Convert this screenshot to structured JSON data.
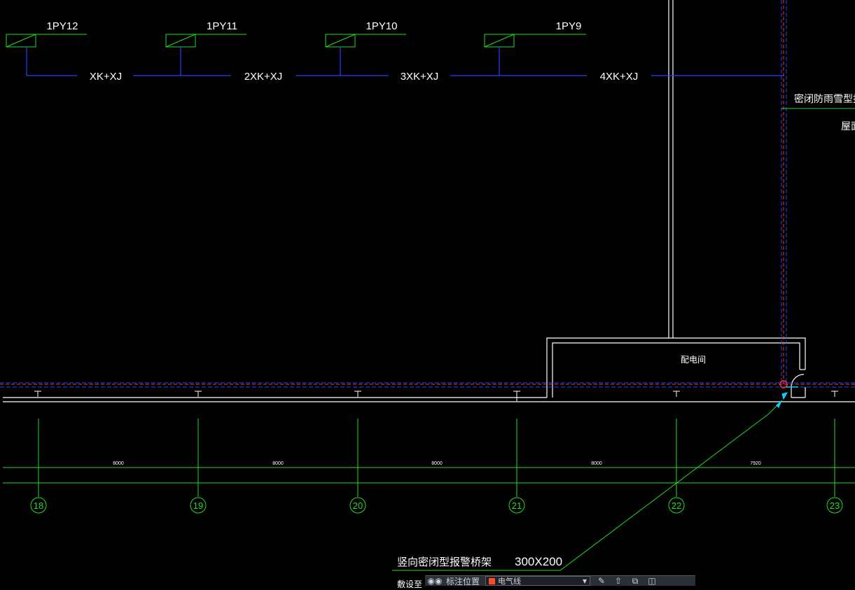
{
  "panels": [
    {
      "label": "1PY12",
      "cable": "XK+XJ"
    },
    {
      "label": "1PY11",
      "cable": "2XK+XJ"
    },
    {
      "label": "1PY10",
      "cable": "3XK+XJ"
    },
    {
      "label": "1PY9",
      "cable": "4XK+XJ"
    }
  ],
  "annotations": {
    "right_top": "密闭防雨雪型报警桥",
    "right_sub": "屋面",
    "room": "配电间",
    "tray_label": "竖向密闭型报警桥架",
    "tray_size": "300X200",
    "bottom_partial": "敷设至"
  },
  "axes": [
    {
      "label": "18"
    },
    {
      "label": "19"
    },
    {
      "label": "20"
    },
    {
      "label": "21"
    },
    {
      "label": "22"
    },
    {
      "label": "23"
    }
  ],
  "dimensions": [
    "8000",
    "8000",
    "8000",
    "8000",
    "7920"
  ],
  "toolbar": {
    "label": "标注位置",
    "layer_value": "电气线",
    "colors": {
      "layer_swatch": "#ff4d1f"
    }
  },
  "colors": {
    "background": "#000000",
    "green": "#22dd22",
    "blue": "#2244ff",
    "white": "#ffffff",
    "red": "#ff3333",
    "cyan": "#00d6ff"
  }
}
